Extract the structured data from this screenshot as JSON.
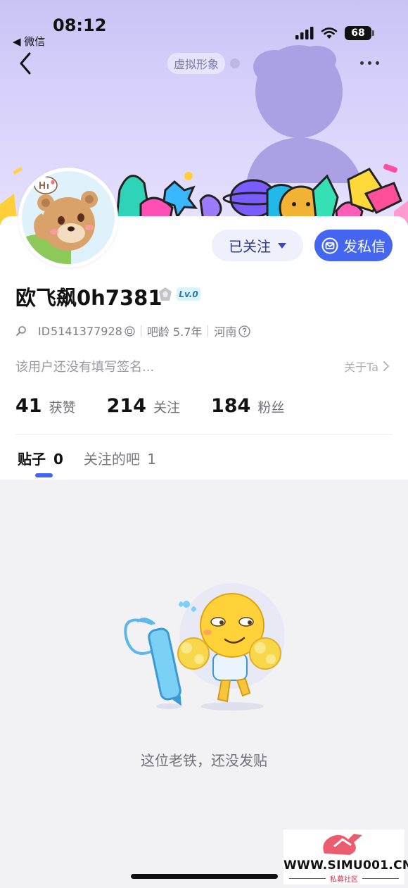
{
  "status_bar": {
    "time": "08:12",
    "back_app": "◀ 微信",
    "battery": "68"
  },
  "header": {
    "virtual_tag": "虚拟形象"
  },
  "profile": {
    "username": "欧飞飙0h7381",
    "level": "Lv.0",
    "id_label": "ID",
    "id_value": "5141377928",
    "bar_age": "吧龄 5.7年",
    "location": "河南",
    "signature": "该用户还没有填写签名...",
    "about": "关于Ta"
  },
  "actions": {
    "follow_label": "已关注",
    "message_label": "发私信"
  },
  "stats": [
    {
      "value": "41",
      "label": "获赞"
    },
    {
      "value": "214",
      "label": "关注"
    },
    {
      "value": "184",
      "label": "粉丝"
    }
  ],
  "tabs": [
    {
      "label": "贴子",
      "count": "0"
    },
    {
      "label": "关注的吧",
      "count": "1"
    }
  ],
  "empty_state": {
    "text": "这位老铁，还没发贴"
  },
  "watermark": {
    "url": "WWW.SIMU001.CN",
    "subtitle": "私募社区"
  },
  "colors": {
    "accent": "#4466f0",
    "header_bg": "#d3ccf8",
    "page_bg": "#f2f2f5"
  },
  "icons": {
    "back": "chevron-left-icon",
    "more": "more-dots-icon",
    "message": "envelope-icon",
    "follow_caret": "caret-down-icon",
    "search": "search-icon",
    "copy": "copy-icon",
    "help": "question-circle-icon",
    "about_arrow": "chevron-right-icon",
    "badge": "crown-badge-icon"
  }
}
